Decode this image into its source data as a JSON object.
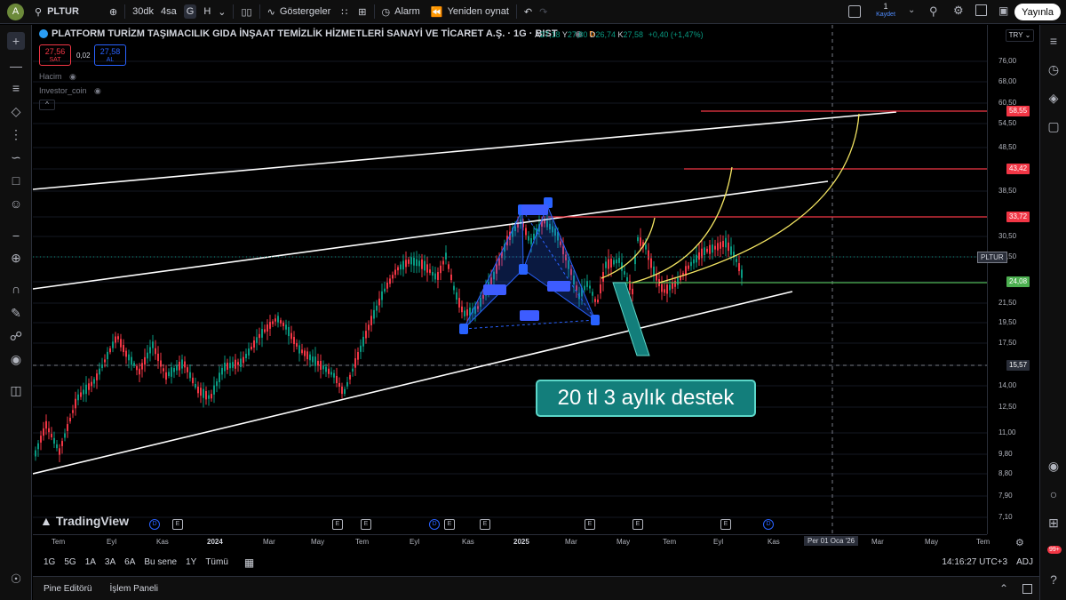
{
  "topbar": {
    "avatar_letter": "A",
    "symbol": "PLTUR",
    "intervals": [
      "30dk",
      "4sa",
      "G",
      "H"
    ],
    "active_interval": "G",
    "indicators_label": "Göstergeler",
    "alarm_label": "Alarm",
    "replay_label": "Yeniden oynat",
    "save_count": "1",
    "save_label": "Kaydet",
    "publish_label": "Yayınla"
  },
  "legend": {
    "title": "PLATFORM TURİZM TAŞIMACILIK GIDA İNŞAAT TEMİZLİK HİZMETLERİ SANAYİ VE TİCARET A.Ş. · 1G · BIST",
    "badge": "D",
    "ohlc": {
      "o_label": "A",
      "o": "27,18",
      "h_label": "Y",
      "h": "27,80",
      "l_label": "D",
      "l": "26,74",
      "c_label": "K",
      "c": "27,58",
      "change": "+0,40 (+1,47%)"
    },
    "sell_price": "27,56",
    "sell_label": "SAT",
    "spread": "0,02",
    "buy_price": "27,58",
    "buy_label": "AL",
    "indicators": [
      "Hacim",
      "Investor_coin"
    ],
    "collapse": "^"
  },
  "price_axis": {
    "currency": "TRY",
    "labels": [
      "76,00",
      "68,00",
      "60,50",
      "54,50",
      "48,50",
      "43,42",
      "38,50",
      "33,72",
      "30,50",
      "27,50",
      "24,08",
      "21,50",
      "19,50",
      "17,50",
      "15,57",
      "14,00",
      "12,50",
      "11,00",
      "9,80",
      "8,80",
      "7,90",
      "7,10"
    ],
    "badges": [
      {
        "value": "58,55",
        "color": "#f23645"
      },
      {
        "value": "43,42",
        "color": "#f23645"
      },
      {
        "value": "33,72",
        "color": "#f23645"
      },
      {
        "value": "24,08",
        "color": "#4caf50"
      },
      {
        "value": "15,57",
        "color": "#2a2e39"
      }
    ],
    "symbol_tag": "PLTUR"
  },
  "time_axis": {
    "labels": [
      "Tem",
      "Eyl",
      "Kas",
      "2024",
      "Mar",
      "May",
      "Tem",
      "Eyl",
      "Kas",
      "2025",
      "Mar",
      "May",
      "Tem",
      "Eyl",
      "Kas",
      "Mar",
      "May",
      "Tem"
    ],
    "crosshair_label": "Per 01 Oca '26"
  },
  "chart": {
    "watermark": "TradingView",
    "callout": "20 tl 3 aylık destek",
    "events": [
      "D",
      "E",
      "E",
      "E",
      "D",
      "E",
      "E",
      "E",
      "E",
      "E",
      "D"
    ]
  },
  "range_bar": {
    "ranges": [
      "1G",
      "5G",
      "1A",
      "3A",
      "6A",
      "Bu sene",
      "1Y",
      "Tümü"
    ],
    "time": "14:16:27 UTC+3",
    "adj": "ADJ"
  },
  "bottom_bar": {
    "tabs": [
      "Pine Editörü",
      "İşlem Paneli"
    ]
  },
  "right_badge": "99+"
}
